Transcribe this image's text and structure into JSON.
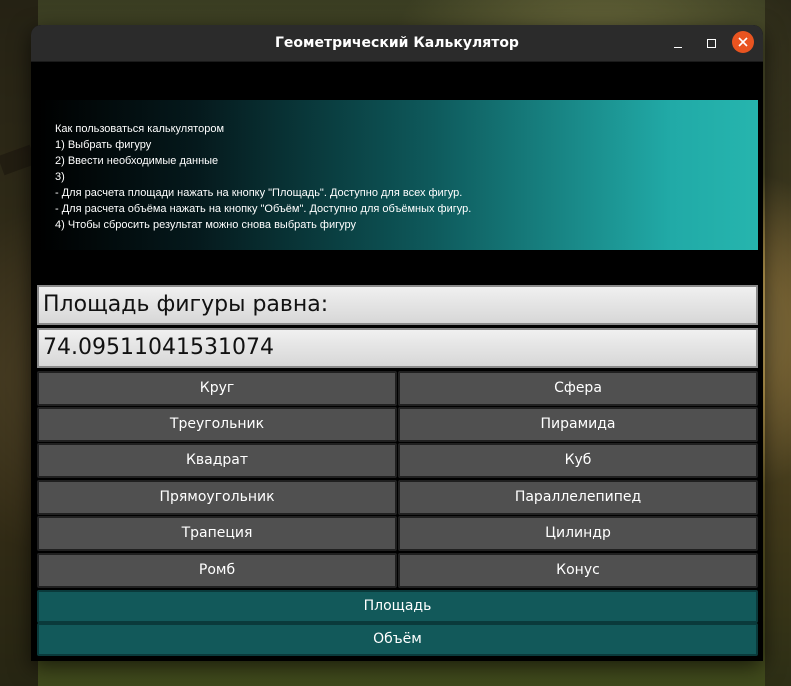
{
  "window": {
    "title": "Геометрический Калькулятор"
  },
  "instructions": {
    "lines": [
      "Как пользоваться калькулятором",
      "1) Выбрать фигуру",
      "2) Ввести необходимые данные",
      "3)",
      "- Для расчета площади нажать на кнопку \"Площадь\". Доступно для всех фигур.",
      "- Для расчета объёма нажать на кнопку \"Объём\". Доступно для объёмных фигур.",
      "4) Чтобы сбросить результат можно снова выбрать фигуру"
    ]
  },
  "result": {
    "label": "Площадь фигуры равна:",
    "value": "74.09511041531074"
  },
  "shapes": {
    "flat": [
      "Круг",
      "Треугольник",
      "Квадрат",
      "Прямоугольник",
      "Трапеция",
      "Ромб"
    ],
    "solid": [
      "Сфера",
      "Пирамида",
      "Куб",
      "Параллелепипед",
      "Цилиндр",
      "Конус"
    ]
  },
  "actions": {
    "area_label": "Площадь",
    "volume_label": "Объём"
  },
  "colors": {
    "titlebar": "#2b2b2b",
    "close_button": "#e95420",
    "shape_button": "#505050",
    "action_button": "#12595a",
    "panel_gradient_end": "#26b5ae"
  }
}
